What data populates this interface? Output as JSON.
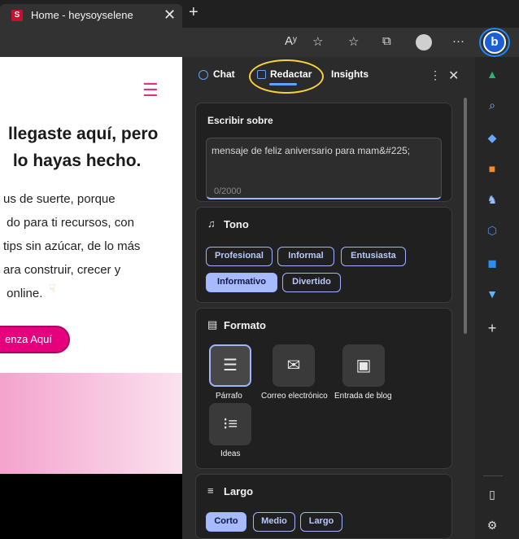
{
  "browser": {
    "tab_title": "Home - heysoyselene",
    "tab_favicon": "S",
    "close_tab": "✕",
    "new_tab": "+",
    "toolbar_icons": [
      "read-aloud-icon",
      "add-favorite-icon",
      "favorites-icon",
      "collections-icon",
      "profile-icon",
      "more-icon",
      "copilot-icon"
    ],
    "read_aloud_text": "Aʸ"
  },
  "webpage": {
    "hero_title": "llegaste aquí, pero\n lo hayas hecho.",
    "hero_text": "us de suerte, porque\n do para ti recursos, con\ntips sin azúcar, de lo más\nara construir, crecer y\n online.",
    "cta_label": "enza Aquí",
    "colors": {
      "accent": "#e6007e",
      "banner_start": "#f4a3cd",
      "banner_end": "#fbe2ef"
    }
  },
  "panel": {
    "tabs": [
      {
        "label": "Chat",
        "icon": "chat-icon"
      },
      {
        "label": "Redactar",
        "icon": "compose-icon",
        "selected": true
      },
      {
        "label": "Insights"
      }
    ],
    "write_about": {
      "label": "Escribir sobre",
      "value": "mensaje de feliz aniversario para mam&#225;",
      "counter": "0/2000"
    },
    "tone": {
      "title": "Tono",
      "options": [
        {
          "label": "Profesional",
          "selected": false
        },
        {
          "label": "Informal",
          "selected": false
        },
        {
          "label": "Entusiasta",
          "selected": false
        },
        {
          "label": "Informativo",
          "selected": true
        },
        {
          "label": "Divertido",
          "selected": false
        }
      ]
    },
    "format": {
      "title": "Formato",
      "options": [
        {
          "label": "Párrafo",
          "icon": "paragraph-icon",
          "selected": true
        },
        {
          "label": "Correo electrónico",
          "icon": "email-icon",
          "selected": false
        },
        {
          "label": "Entrada de blog",
          "icon": "blog-post-icon",
          "selected": false
        },
        {
          "label": "Ideas",
          "icon": "ideas-list-icon",
          "selected": false
        }
      ]
    },
    "length": {
      "title": "Largo",
      "options": [
        {
          "label": "Corto",
          "selected": true
        },
        {
          "label": "Medio",
          "selected": false
        },
        {
          "label": "Largo",
          "selected": false
        }
      ]
    },
    "colors": {
      "chip_border": "#9fb4ff",
      "chip_selected_bg": "#a7b9ff",
      "highlight": "#f7d23e"
    }
  },
  "edge_sidebar_icons": [
    "tree-icon",
    "search-icon",
    "tag-icon",
    "briefcase-icon",
    "games-icon",
    "office-icon",
    "outlook-icon",
    "send-icon",
    "add-icon",
    "sidebar-toggle-icon",
    "settings-icon"
  ]
}
